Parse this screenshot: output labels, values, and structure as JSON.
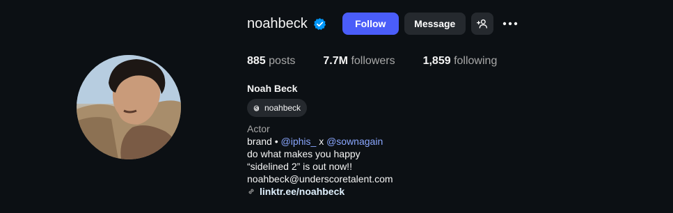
{
  "profile": {
    "username": "noahbeck",
    "full_name": "Noah Beck",
    "threads_handle": "noahbeck",
    "category": "Actor",
    "verified": true
  },
  "actions": {
    "follow_label": "Follow",
    "message_label": "Message"
  },
  "stats": [
    {
      "value": "885",
      "label": "posts"
    },
    {
      "value": "7.7M",
      "label": "followers"
    },
    {
      "value": "1,859",
      "label": "following"
    }
  ],
  "bio": {
    "line1_prefix": "brand •",
    "mention1": "@iphis_",
    "line1_sep": "x",
    "mention2": "@sownagain",
    "line2": "do what makes you happy",
    "line3": "“sidelined 2” is out now!!",
    "line4": "noahbeck@underscoretalent.com",
    "link": "linktr.ee/noahbeck"
  },
  "colors": {
    "background": "#0c1014",
    "follow_button": "#4a5df9",
    "secondary_button": "#25292e",
    "verified_badge": "#0095f6",
    "mention": "#8aa7ff"
  },
  "icons": [
    "verified-badge-icon",
    "add-user-icon",
    "more-options-icon",
    "threads-icon",
    "link-icon"
  ]
}
